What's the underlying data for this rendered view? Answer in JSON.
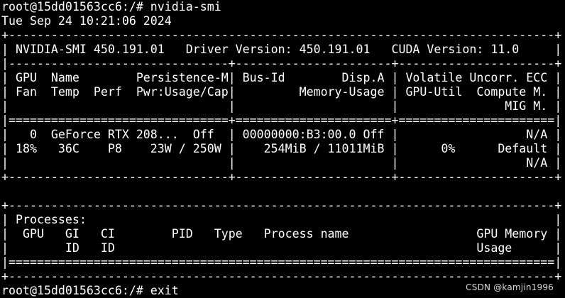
{
  "terminal": {
    "prompt_cmd": "root@15dd01563cc6:/# nvidia-smi",
    "timestamp": "Tue Sep 24 10:21:06 2024",
    "smi_version": "450.191.01",
    "driver_version": "450.191.01",
    "cuda_version": "11.0",
    "lines": [
      "root@15dd01563cc6:/# nvidia-smi",
      "Tue Sep 24 10:21:06 2024",
      "+-----------------------------------------------------------------------------+",
      "| NVIDIA-SMI 450.191.01   Driver Version: 450.191.01   CUDA Version: 11.0     |",
      "|-------------------------------+----------------------+----------------------+",
      "| GPU  Name        Persistence-M| Bus-Id        Disp.A | Volatile Uncorr. ECC |",
      "| Fan  Temp  Perf  Pwr:Usage/Cap|         Memory-Usage | GPU-Util  Compute M. |",
      "|                               |                      |               MIG M. |",
      "|===============================+======================+======================|",
      "|   0  GeForce RTX 208...  Off  | 00000000:B3:00.0 Off |                  N/A |",
      "| 18%   36C    P8    23W / 250W |    254MiB / 11011MiB |      0%      Default |",
      "|                               |                      |                  N/A |",
      "+-------------------------------+----------------------+----------------------+",
      "",
      "+-----------------------------------------------------------------------------+",
      "| Processes:                                                                  |",
      "|  GPU   GI   CI        PID   Type   Process name                  GPU Memory |",
      "|        ID   ID                                                   Usage      |",
      "|=============================================================================|",
      "+-----------------------------------------------------------------------------+",
      "root@15dd01563cc6:/# exit"
    ]
  },
  "gpu": {
    "index": "0",
    "name": "GeForce RTX 208...",
    "persistence_mode": "Off",
    "bus_id": "00000000:B3:00.0",
    "display_active": "Off",
    "ecc": "N/A",
    "fan": "18%",
    "temp": "36C",
    "perf": "P8",
    "power_usage": "23W",
    "power_cap": "250W",
    "memory_used": "254MiB",
    "memory_total": "11011MiB",
    "gpu_util": "0%",
    "compute_mode": "Default",
    "mig_mode": "N/A"
  },
  "watermark": {
    "text": "CSDN @kamjin1996"
  },
  "colors": {
    "background": "#000000",
    "foreground": "#ffffff",
    "watermark": "#d8d8d8"
  }
}
